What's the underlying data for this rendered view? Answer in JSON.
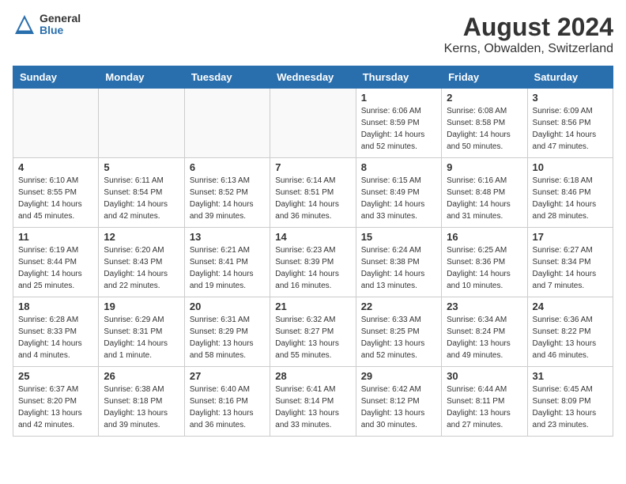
{
  "logo": {
    "general": "General",
    "blue": "Blue"
  },
  "title": "August 2024",
  "subtitle": "Kerns, Obwalden, Switzerland",
  "days_of_week": [
    "Sunday",
    "Monday",
    "Tuesday",
    "Wednesday",
    "Thursday",
    "Friday",
    "Saturday"
  ],
  "weeks": [
    [
      {
        "day": "",
        "info": ""
      },
      {
        "day": "",
        "info": ""
      },
      {
        "day": "",
        "info": ""
      },
      {
        "day": "",
        "info": ""
      },
      {
        "day": "1",
        "info": "Sunrise: 6:06 AM\nSunset: 8:59 PM\nDaylight: 14 hours\nand 52 minutes."
      },
      {
        "day": "2",
        "info": "Sunrise: 6:08 AM\nSunset: 8:58 PM\nDaylight: 14 hours\nand 50 minutes."
      },
      {
        "day": "3",
        "info": "Sunrise: 6:09 AM\nSunset: 8:56 PM\nDaylight: 14 hours\nand 47 minutes."
      }
    ],
    [
      {
        "day": "4",
        "info": "Sunrise: 6:10 AM\nSunset: 8:55 PM\nDaylight: 14 hours\nand 45 minutes."
      },
      {
        "day": "5",
        "info": "Sunrise: 6:11 AM\nSunset: 8:54 PM\nDaylight: 14 hours\nand 42 minutes."
      },
      {
        "day": "6",
        "info": "Sunrise: 6:13 AM\nSunset: 8:52 PM\nDaylight: 14 hours\nand 39 minutes."
      },
      {
        "day": "7",
        "info": "Sunrise: 6:14 AM\nSunset: 8:51 PM\nDaylight: 14 hours\nand 36 minutes."
      },
      {
        "day": "8",
        "info": "Sunrise: 6:15 AM\nSunset: 8:49 PM\nDaylight: 14 hours\nand 33 minutes."
      },
      {
        "day": "9",
        "info": "Sunrise: 6:16 AM\nSunset: 8:48 PM\nDaylight: 14 hours\nand 31 minutes."
      },
      {
        "day": "10",
        "info": "Sunrise: 6:18 AM\nSunset: 8:46 PM\nDaylight: 14 hours\nand 28 minutes."
      }
    ],
    [
      {
        "day": "11",
        "info": "Sunrise: 6:19 AM\nSunset: 8:44 PM\nDaylight: 14 hours\nand 25 minutes."
      },
      {
        "day": "12",
        "info": "Sunrise: 6:20 AM\nSunset: 8:43 PM\nDaylight: 14 hours\nand 22 minutes."
      },
      {
        "day": "13",
        "info": "Sunrise: 6:21 AM\nSunset: 8:41 PM\nDaylight: 14 hours\nand 19 minutes."
      },
      {
        "day": "14",
        "info": "Sunrise: 6:23 AM\nSunset: 8:39 PM\nDaylight: 14 hours\nand 16 minutes."
      },
      {
        "day": "15",
        "info": "Sunrise: 6:24 AM\nSunset: 8:38 PM\nDaylight: 14 hours\nand 13 minutes."
      },
      {
        "day": "16",
        "info": "Sunrise: 6:25 AM\nSunset: 8:36 PM\nDaylight: 14 hours\nand 10 minutes."
      },
      {
        "day": "17",
        "info": "Sunrise: 6:27 AM\nSunset: 8:34 PM\nDaylight: 14 hours\nand 7 minutes."
      }
    ],
    [
      {
        "day": "18",
        "info": "Sunrise: 6:28 AM\nSunset: 8:33 PM\nDaylight: 14 hours\nand 4 minutes."
      },
      {
        "day": "19",
        "info": "Sunrise: 6:29 AM\nSunset: 8:31 PM\nDaylight: 14 hours\nand 1 minute."
      },
      {
        "day": "20",
        "info": "Sunrise: 6:31 AM\nSunset: 8:29 PM\nDaylight: 13 hours\nand 58 minutes."
      },
      {
        "day": "21",
        "info": "Sunrise: 6:32 AM\nSunset: 8:27 PM\nDaylight: 13 hours\nand 55 minutes."
      },
      {
        "day": "22",
        "info": "Sunrise: 6:33 AM\nSunset: 8:25 PM\nDaylight: 13 hours\nand 52 minutes."
      },
      {
        "day": "23",
        "info": "Sunrise: 6:34 AM\nSunset: 8:24 PM\nDaylight: 13 hours\nand 49 minutes."
      },
      {
        "day": "24",
        "info": "Sunrise: 6:36 AM\nSunset: 8:22 PM\nDaylight: 13 hours\nand 46 minutes."
      }
    ],
    [
      {
        "day": "25",
        "info": "Sunrise: 6:37 AM\nSunset: 8:20 PM\nDaylight: 13 hours\nand 42 minutes."
      },
      {
        "day": "26",
        "info": "Sunrise: 6:38 AM\nSunset: 8:18 PM\nDaylight: 13 hours\nand 39 minutes."
      },
      {
        "day": "27",
        "info": "Sunrise: 6:40 AM\nSunset: 8:16 PM\nDaylight: 13 hours\nand 36 minutes."
      },
      {
        "day": "28",
        "info": "Sunrise: 6:41 AM\nSunset: 8:14 PM\nDaylight: 13 hours\nand 33 minutes."
      },
      {
        "day": "29",
        "info": "Sunrise: 6:42 AM\nSunset: 8:12 PM\nDaylight: 13 hours\nand 30 minutes."
      },
      {
        "day": "30",
        "info": "Sunrise: 6:44 AM\nSunset: 8:11 PM\nDaylight: 13 hours\nand 27 minutes."
      },
      {
        "day": "31",
        "info": "Sunrise: 6:45 AM\nSunset: 8:09 PM\nDaylight: 13 hours\nand 23 minutes."
      }
    ]
  ]
}
